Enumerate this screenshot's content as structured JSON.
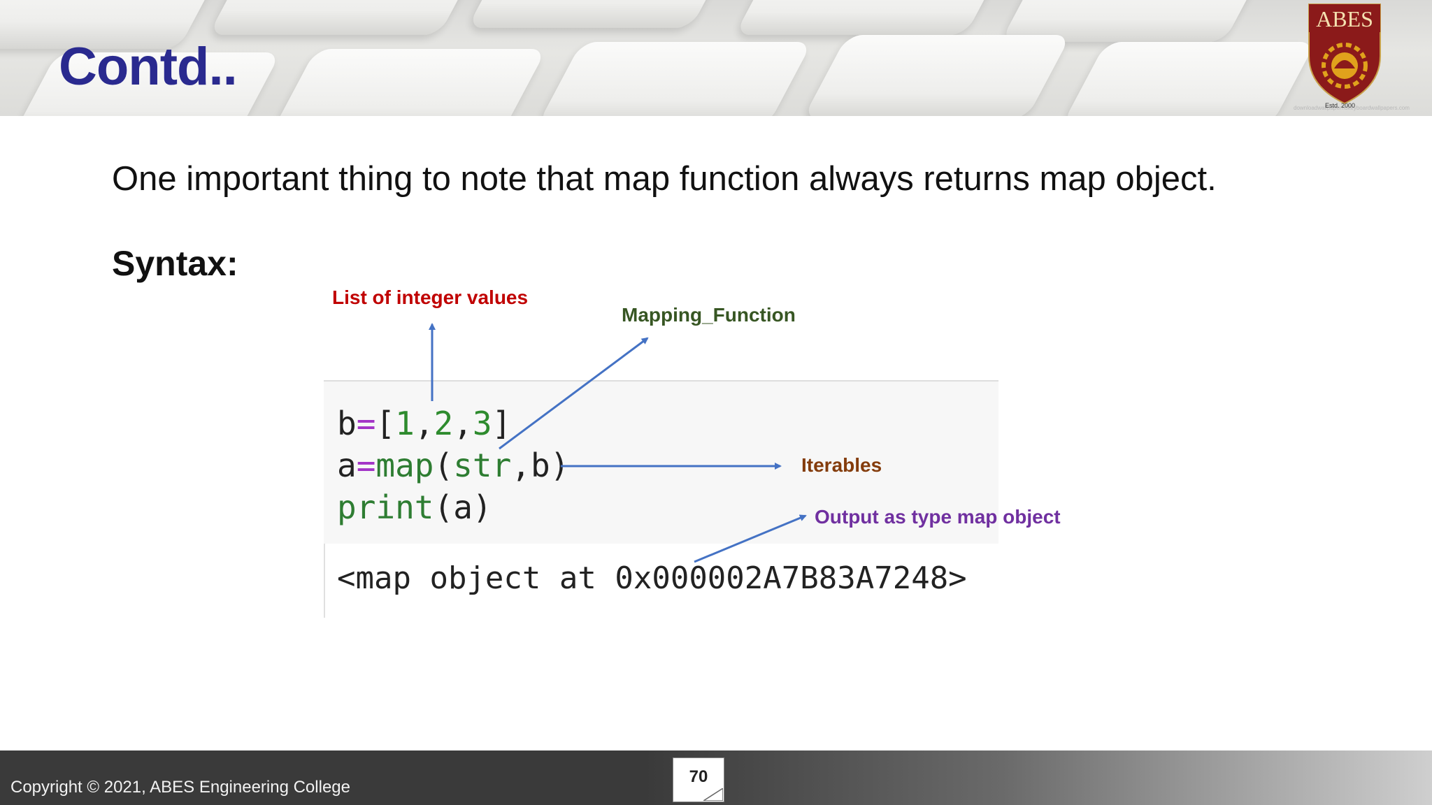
{
  "slide": {
    "title": "Contd..",
    "intro": "One important thing to note that map function always returns map object.",
    "syntax_heading": "Syntax:"
  },
  "logo": {
    "text": "ABES",
    "est": "Estd. 2000",
    "credit": "downloadwallpaperhdkeyboardwallpapers.com",
    "colors": {
      "shield": "#8b1a1a",
      "gold": "#e0a21c"
    }
  },
  "code": {
    "line1": {
      "var": "b",
      "op": "=",
      "open": "[",
      "n1": "1",
      "c1": ",",
      "n2": "2",
      "c2": ",",
      "n3": "3",
      "close": "]"
    },
    "line2": {
      "var": "a",
      "op": "=",
      "fn": "map",
      "open": "(",
      "arg1": "str",
      "comma": ",",
      "arg2": "b",
      "close": ")"
    },
    "line3": {
      "fn": "print",
      "open": "(",
      "arg": "a",
      "close": ")"
    },
    "output": "<map object at 0x000002A7B83A7248>"
  },
  "annotations": {
    "list": "List of integer values",
    "mapping": "Mapping_Function",
    "iterables": "Iterables",
    "output": "Output as type map object",
    "colors": {
      "list": "#c00000",
      "mapping": "#375623",
      "iterables": "#843c0c",
      "output": "#7030a0",
      "arrow": "#4472c4"
    }
  },
  "footer": {
    "copyright": "Copyright © 2021, ABES Engineering College",
    "page_number": "70"
  }
}
